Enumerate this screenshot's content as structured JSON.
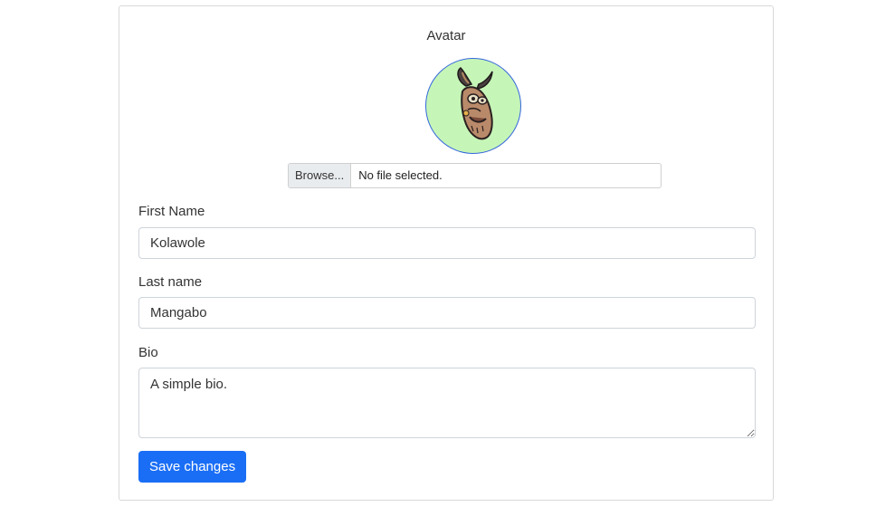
{
  "avatar": {
    "label": "Avatar",
    "icon": "rabbit-cartoon-avatar",
    "background_color": "#c6f5b8",
    "border_color": "#3366dd"
  },
  "file_input": {
    "browse_label": "Browse...",
    "status_text": "No file selected."
  },
  "form": {
    "first_name": {
      "label": "First Name",
      "value": "Kolawole"
    },
    "last_name": {
      "label": "Last name",
      "value": "Mangabo"
    },
    "bio": {
      "label": "Bio",
      "value": "A simple bio."
    }
  },
  "actions": {
    "save_label": "Save changes",
    "accent_color": "#1a6ef5"
  }
}
